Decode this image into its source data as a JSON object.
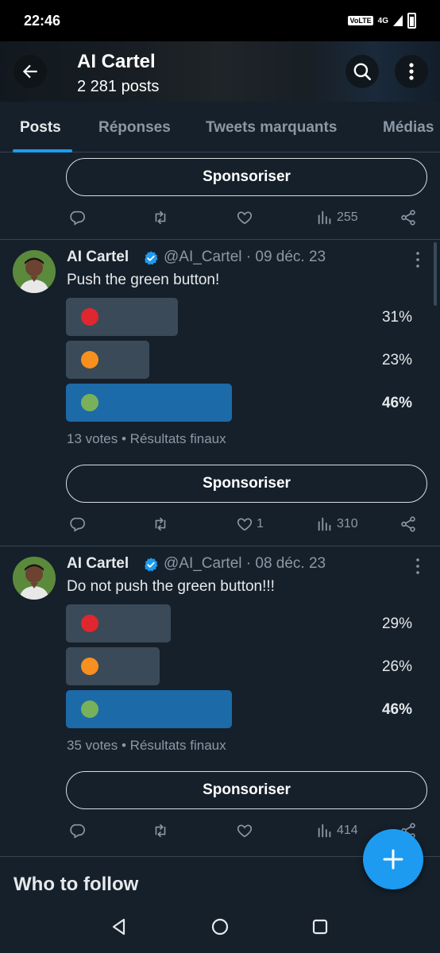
{
  "status": {
    "time": "22:46",
    "volte": "VoLTE",
    "network": "4G"
  },
  "header": {
    "title": "AI Cartel",
    "subtitle": "2 281 posts"
  },
  "tabs": [
    "Posts",
    "Réponses",
    "Tweets marquants",
    "Médias"
  ],
  "top_post": {
    "sponsor": "Sponsoriser",
    "views": "255"
  },
  "posts": [
    {
      "name": "AI Cartel",
      "meta": "@AI_Cartel · 09 déc. 23",
      "text": "Push the green button!",
      "options": [
        {
          "emoji": "red-circle",
          "color": "#e0262f",
          "pct": "31%",
          "value": 0.31
        },
        {
          "emoji": "orange-circle",
          "color": "#f7901e",
          "pct": "23%",
          "value": 0.23
        },
        {
          "emoji": "green-circle",
          "color": "#78b159",
          "pct": "46%",
          "value": 0.46,
          "winner": true
        }
      ],
      "summary": "13 votes • Résultats finaux",
      "sponsor": "Sponsoriser",
      "likes": "1",
      "views": "310"
    },
    {
      "name": "AI Cartel",
      "meta": "@AI_Cartel · 08 déc. 23",
      "text": "Do not push the green button!!!",
      "options": [
        {
          "emoji": "red-circle",
          "color": "#e0262f",
          "pct": "29%",
          "value": 0.29
        },
        {
          "emoji": "orange-circle",
          "color": "#f7901e",
          "pct": "26%",
          "value": 0.26
        },
        {
          "emoji": "green-circle",
          "color": "#78b159",
          "pct": "46%",
          "value": 0.46,
          "winner": true
        }
      ],
      "summary": "35 votes • Résultats finaux",
      "sponsor": "Sponsoriser",
      "likes": "",
      "views": "414"
    }
  ],
  "section": {
    "who_to_follow": "Who to follow"
  },
  "colors": {
    "accent": "#1d9bf0",
    "background": "#15202b",
    "winner_bar": "#1d6aa8",
    "bar": "#3b4a58"
  }
}
